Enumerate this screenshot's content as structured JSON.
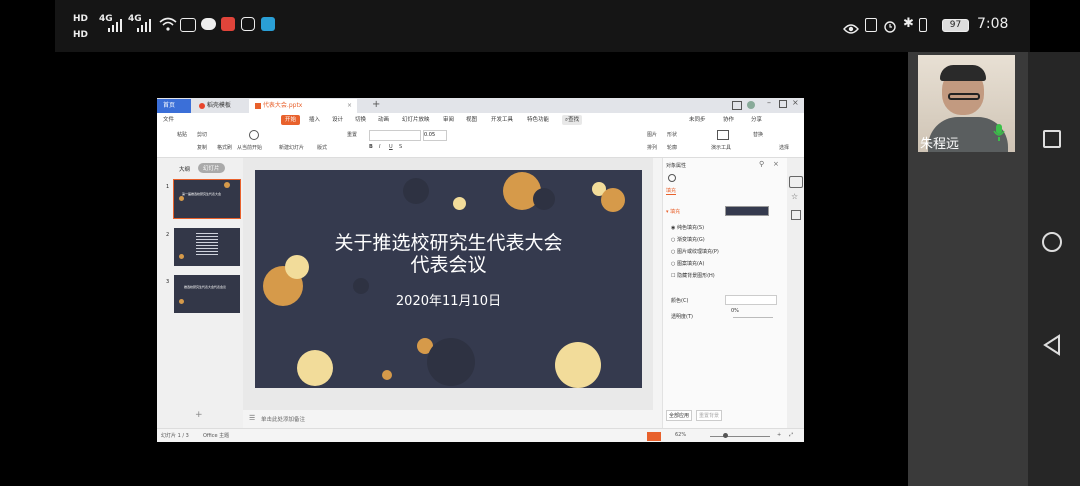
{
  "statusbar": {
    "net1": "HD",
    "net2": "HD",
    "sig1": "4G",
    "sig2": "4G",
    "battery": "97",
    "time": "7:08"
  },
  "video": {
    "name": "朱程远"
  },
  "wps": {
    "tabs": {
      "home": "首页",
      "template": "稻壳模板",
      "file": "代表大会.pptx"
    },
    "menus": [
      "文件",
      "开始",
      "插入",
      "设计",
      "切换",
      "动画",
      "幻灯片放映",
      "审阅",
      "视图",
      "开发工具",
      "特色功能"
    ],
    "search": "查找",
    "sync": "未同步",
    "collab": "协作",
    "share": "分享",
    "ribbon": {
      "paste": "粘贴",
      "cut": "剪切",
      "copy": "复制",
      "format": "格式刷",
      "play": "从当前开始",
      "new_slide": "新建幻灯片",
      "layout": "版式",
      "reset": "重置",
      "section": "节",
      "font_size": "0.05",
      "picture": "图片",
      "shape": "形状",
      "arrange": "排列",
      "outline": "轮廓",
      "textbox": "文本框",
      "style": "演示工具",
      "replace": "替换",
      "select": "选择",
      "demo": "演示工具"
    },
    "thumbpane": {
      "outline_tab": "大纲",
      "slides_tab": "幻灯片",
      "add": "+",
      "nums": [
        "1",
        "2",
        "3"
      ],
      "t1": "第一届推选校研究生代表大会",
      "t3": "推选校研究生代表大会代表会议"
    },
    "slide": {
      "title_line1": "关于推选校研究生代表大会",
      "title_line2": "代表会议",
      "date": "2020年11月10日"
    },
    "notes": "单击此处添加备注",
    "props": {
      "title": "对象属性",
      "tab": "填充",
      "section": "填充",
      "opt1": "纯色填充(S)",
      "opt2": "渐变填充(G)",
      "opt3": "图片或纹理填充(P)",
      "opt4": "图案填充(A)",
      "opt5": "隐藏背景图形(H)",
      "color_label": "颜色(C)",
      "transparency_label": "透明度(T)",
      "transparency_value": "0%",
      "apply_all": "全部应用",
      "reset_bg": "重置背景"
    },
    "status": {
      "slide_no": "幻灯片 1 / 3",
      "theme": "Office 主题",
      "zoom": "62%"
    }
  },
  "colors": {
    "slide_bg": "#353a4e",
    "gold": "#d69a4a",
    "cream": "#f2dc9a",
    "accent": "#e8612c"
  }
}
